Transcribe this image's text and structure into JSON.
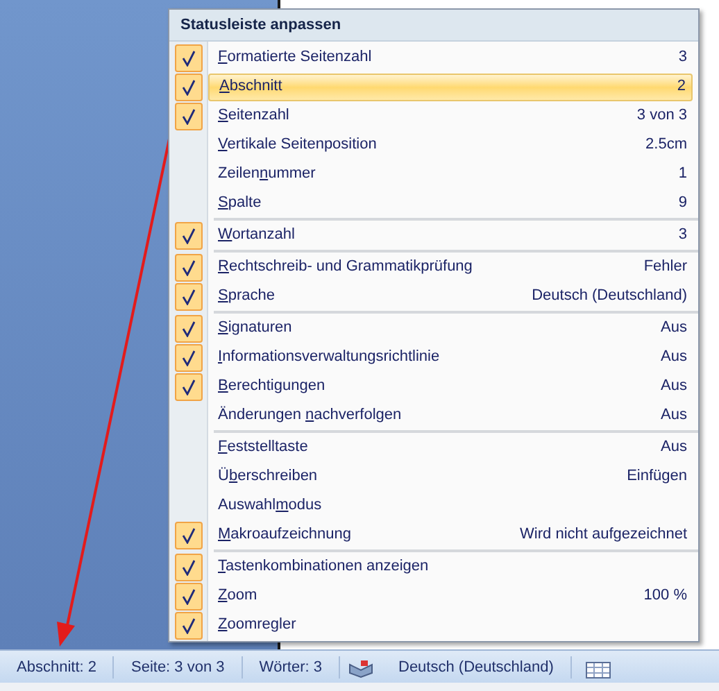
{
  "menu": {
    "title": "Statusleiste anpassen",
    "groups": [
      [
        {
          "key": "F",
          "post": "ormatierte Seitenzahl",
          "value": "3",
          "checked": true,
          "selected": false
        },
        {
          "key": "A",
          "post": "bschnitt",
          "value": "2",
          "checked": true,
          "selected": true
        },
        {
          "key": "S",
          "post": "eitenzahl",
          "value": "3 von 3",
          "checked": true,
          "selected": false
        },
        {
          "key": "V",
          "post": "ertikale Seitenposition",
          "value": "2.5cm",
          "checked": false,
          "selected": false
        },
        {
          "pre": "Zeilen",
          "key": "n",
          "post": "ummer",
          "value": "1",
          "checked": false,
          "selected": false
        },
        {
          "key": "S",
          "post": "palte",
          "value": "9",
          "checked": false,
          "selected": false
        }
      ],
      [
        {
          "key": "W",
          "post": "ortanzahl",
          "value": "3",
          "checked": true,
          "selected": false
        }
      ],
      [
        {
          "key": "R",
          "post": "echtschreib- und Grammatikprüfung",
          "value": "Fehler",
          "checked": true,
          "selected": false
        },
        {
          "key": "S",
          "post": "prache",
          "value": "Deutsch (Deutschland)",
          "checked": true,
          "selected": false
        }
      ],
      [
        {
          "key": "S",
          "post": "ignaturen",
          "value": "Aus",
          "checked": true,
          "selected": false
        },
        {
          "key": "I",
          "post": "nformationsverwaltungsrichtlinie",
          "value": "Aus",
          "checked": true,
          "selected": false
        },
        {
          "key": "B",
          "post": "erechtigungen",
          "value": "Aus",
          "checked": true,
          "selected": false
        },
        {
          "pre": "Änderungen ",
          "key": "n",
          "post": "achverfolgen",
          "value": "Aus",
          "checked": false,
          "selected": false
        }
      ],
      [
        {
          "key": "F",
          "post": "eststelltaste",
          "value": "Aus",
          "checked": false,
          "selected": false
        },
        {
          "pre": "Ü",
          "key": "b",
          "post": "erschreiben",
          "value": "Einfügen",
          "checked": false,
          "selected": false
        },
        {
          "pre": "Auswahl",
          "key": "m",
          "post": "odus",
          "checked": false,
          "selected": false
        },
        {
          "key": "M",
          "post": "akroaufzeichnung",
          "value": "Wird nicht aufgezeichnet",
          "checked": true,
          "selected": false
        }
      ],
      [
        {
          "key": "T",
          "post": "astenkombinationen anzeigen",
          "checked": true,
          "selected": false
        },
        {
          "key": "Z",
          "post": "oom",
          "value": "100 %",
          "checked": true,
          "selected": false
        },
        {
          "key": "Z",
          "post": "oomregler",
          "checked": true,
          "selected": false
        }
      ]
    ]
  },
  "status_bar": {
    "items": [
      {
        "kind": "text",
        "label": "Abschnitt: 2"
      },
      {
        "kind": "text",
        "label": "Seite: 3 von 3"
      },
      {
        "kind": "text",
        "label": "Wörter: 3"
      },
      {
        "kind": "icon"
      },
      {
        "kind": "text",
        "label": "Deutsch (Deutschland)"
      },
      {
        "kind": "layout"
      }
    ]
  }
}
